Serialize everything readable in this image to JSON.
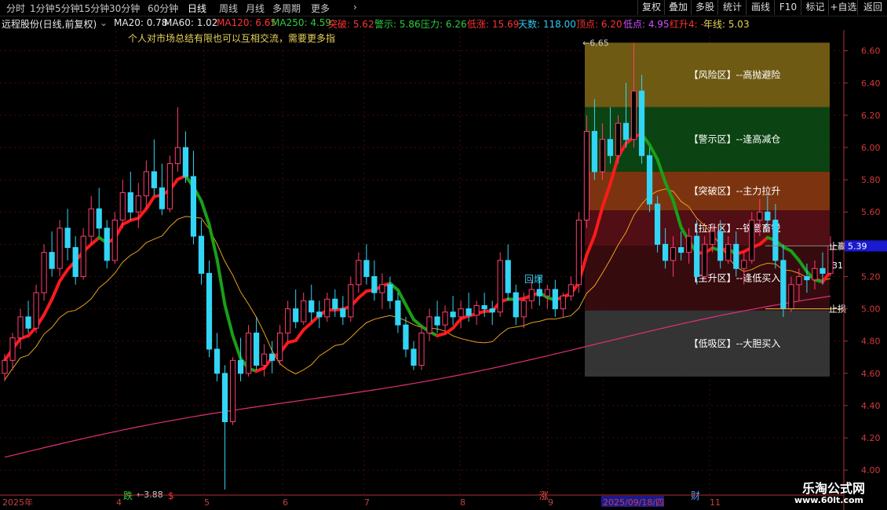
{
  "toolbar": {
    "timeframes": [
      "分时",
      "1分钟",
      "5分钟",
      "15分钟",
      "30分钟",
      "60分钟",
      "日线",
      "周线",
      "月线",
      "多周期",
      "更多"
    ],
    "active_timeframe": "日线",
    "right_buttons": [
      "复权",
      "叠加",
      "多股",
      "统计",
      "画线",
      "F10",
      "标记",
      "+自选",
      "返回"
    ]
  },
  "info": {
    "title": "远程股份(日线,前复权)",
    "ma20": "MA20: 0.78",
    "ma60": "MA60: 1.02",
    "ma120": "MA120: 6.65",
    "ma250": "MA250: 4.59",
    "breakout": "突破: 5.62",
    "warning": "警示: 5.86",
    "pressure": "压力: 6.26",
    "low_rise": "低涨: 15.69",
    "days": "天数: 118.00",
    "top": "顶点: 6.20",
    "bottom": "低点: 4.95",
    "red_rise": "红升4: -",
    "year_line": "年线: 5.03"
  },
  "note": "个人对市场总结有限也可以互相交流，需要更多指",
  "colors": {
    "up": "#ff3d6f",
    "down": "#33d5f5",
    "ma_main_up": "#ff1a1a",
    "ma_main_down": "#18a018",
    "ma250": "#e0307a",
    "ma_orange": "#e6a020",
    "axis": "#b03030"
  },
  "chart_data": {
    "type": "candlestick",
    "y_ticks": [
      "6.60",
      "6.40",
      "6.20",
      "6.00",
      "5.80",
      "5.60",
      "5.40",
      "5.20",
      "5.00",
      "4.80",
      "4.60",
      "4.40",
      "4.20",
      "4.00"
    ],
    "ylim": [
      3.85,
      6.72
    ],
    "x_labels": [
      "2025年",
      "4",
      "5",
      "6",
      "7",
      "8",
      "9",
      "2025/09/18/四",
      "11"
    ],
    "high_mark": "6.65",
    "low_mark": "3.88",
    "current_price": "5.39",
    "right_labels": [
      "止赢",
      "31",
      "止损"
    ],
    "markers": [
      "跌",
      "$",
      "涨",
      "财",
      "回爆"
    ],
    "zones": [
      {
        "label": "【风险区】--高抛避险",
        "from": 6.25,
        "to": 6.65,
        "color": "#7a6414"
      },
      {
        "label": "【警示区】--逢高减仓",
        "from": 5.85,
        "to": 6.25,
        "color": "#0d4a14"
      },
      {
        "label": "【突破区】--主力拉升",
        "from": 5.61,
        "to": 5.85,
        "color": "#8a3a12"
      },
      {
        "label": "【拉升区】--锐意畜锐",
        "from": 5.39,
        "to": 5.61,
        "color": "#5a1016"
      },
      {
        "label": "【主升区】--逢低买入",
        "from": 4.99,
        "to": 5.39,
        "color": "#3c0c0f"
      },
      {
        "label": "【低吸区】--大胆买入",
        "from": 4.58,
        "to": 4.99,
        "color": "#3a3a3a"
      }
    ],
    "candles": [
      [
        4.6,
        4.72,
        4.55,
        4.68
      ],
      [
        4.68,
        4.85,
        4.62,
        4.82
      ],
      [
        4.82,
        5.0,
        4.75,
        4.95
      ],
      [
        4.95,
        5.05,
        4.85,
        4.88
      ],
      [
        4.88,
        5.15,
        4.85,
        5.1
      ],
      [
        5.1,
        5.4,
        5.05,
        5.35
      ],
      [
        5.35,
        5.48,
        5.2,
        5.25
      ],
      [
        5.25,
        5.55,
        5.2,
        5.5
      ],
      [
        5.5,
        5.62,
        5.3,
        5.38
      ],
      [
        5.38,
        5.45,
        5.15,
        5.2
      ],
      [
        5.2,
        5.5,
        5.18,
        5.45
      ],
      [
        5.45,
        5.7,
        5.4,
        5.62
      ],
      [
        5.62,
        5.75,
        5.45,
        5.5
      ],
      [
        5.5,
        5.55,
        5.25,
        5.3
      ],
      [
        5.3,
        5.6,
        5.28,
        5.55
      ],
      [
        5.55,
        5.8,
        5.5,
        5.72
      ],
      [
        5.72,
        5.85,
        5.55,
        5.6
      ],
      [
        5.6,
        5.78,
        5.5,
        5.7
      ],
      [
        5.7,
        5.92,
        5.62,
        5.85
      ],
      [
        5.85,
        6.05,
        5.7,
        5.75
      ],
      [
        5.75,
        5.9,
        5.58,
        5.62
      ],
      [
        5.62,
        5.95,
        5.6,
        5.9
      ],
      [
        5.9,
        6.25,
        5.85,
        6.0
      ],
      [
        6.0,
        6.1,
        5.78,
        5.82
      ],
      [
        5.82,
        5.98,
        5.4,
        5.45
      ],
      [
        5.45,
        5.55,
        5.15,
        5.22
      ],
      [
        5.22,
        5.3,
        4.7,
        4.75
      ],
      [
        4.75,
        4.85,
        4.55,
        4.6
      ],
      [
        4.6,
        4.65,
        3.88,
        4.3
      ],
      [
        4.3,
        4.7,
        4.28,
        4.68
      ],
      [
        4.68,
        4.82,
        4.55,
        4.6
      ],
      [
        4.6,
        4.9,
        4.58,
        4.85
      ],
      [
        4.85,
        4.95,
        4.62,
        4.65
      ],
      [
        4.65,
        4.78,
        4.58,
        4.72
      ],
      [
        4.72,
        4.8,
        4.6,
        4.68
      ],
      [
        4.68,
        4.9,
        4.65,
        4.85
      ],
      [
        4.85,
        5.05,
        4.8,
        5.0
      ],
      [
        5.0,
        5.12,
        4.88,
        4.92
      ],
      [
        4.92,
        5.1,
        4.9,
        5.05
      ],
      [
        5.05,
        5.15,
        4.92,
        4.98
      ],
      [
        4.98,
        5.05,
        4.88,
        4.95
      ],
      [
        4.95,
        5.1,
        4.92,
        5.06
      ],
      [
        5.06,
        5.12,
        4.95,
        5.0
      ],
      [
        5.0,
        5.08,
        4.9,
        4.95
      ],
      [
        4.95,
        5.2,
        4.92,
        5.15
      ],
      [
        5.15,
        5.35,
        5.1,
        5.3
      ],
      [
        5.3,
        5.4,
        5.15,
        5.2
      ],
      [
        5.2,
        5.3,
        5.05,
        5.1
      ],
      [
        5.1,
        5.22,
        5.0,
        5.15
      ],
      [
        5.15,
        5.2,
        5.0,
        5.05
      ],
      [
        5.05,
        5.1,
        4.85,
        4.9
      ],
      [
        4.9,
        4.95,
        4.7,
        4.75
      ],
      [
        4.75,
        4.8,
        4.62,
        4.65
      ],
      [
        4.65,
        4.9,
        4.62,
        4.85
      ],
      [
        4.85,
        5.0,
        4.8,
        4.95
      ],
      [
        4.95,
        5.05,
        4.85,
        4.9
      ],
      [
        4.9,
        5.02,
        4.85,
        4.98
      ],
      [
        4.98,
        5.08,
        4.9,
        4.95
      ],
      [
        4.95,
        5.05,
        4.88,
        5.0
      ],
      [
        5.0,
        5.1,
        4.92,
        4.96
      ],
      [
        4.96,
        5.05,
        4.9,
        5.02
      ],
      [
        5.02,
        5.1,
        4.95,
        5.0
      ],
      [
        5.0,
        5.05,
        4.9,
        4.98
      ],
      [
        4.98,
        5.35,
        4.95,
        5.3
      ],
      [
        5.3,
        5.4,
        5.05,
        5.1
      ],
      [
        5.1,
        5.15,
        4.9,
        4.95
      ],
      [
        4.95,
        5.1,
        4.88,
        5.05
      ],
      [
        5.05,
        5.18,
        5.0,
        5.12
      ],
      [
        5.12,
        5.2,
        5.02,
        5.08
      ],
      [
        5.08,
        5.15,
        5.0,
        5.12
      ],
      [
        5.12,
        5.18,
        4.95,
        5.0
      ],
      [
        5.0,
        5.1,
        4.95,
        5.08
      ],
      [
        5.08,
        5.2,
        5.05,
        5.15
      ],
      [
        5.15,
        5.6,
        5.1,
        5.55
      ],
      [
        5.55,
        6.2,
        5.5,
        6.1
      ],
      [
        6.1,
        6.3,
        5.8,
        5.85
      ],
      [
        5.85,
        6.15,
        5.8,
        6.05
      ],
      [
        6.05,
        6.25,
        5.9,
        5.95
      ],
      [
        5.95,
        6.2,
        5.9,
        6.15
      ],
      [
        6.15,
        6.4,
        6.0,
        6.05
      ],
      [
        6.05,
        6.65,
        6.0,
        6.35
      ],
      [
        6.35,
        6.45,
        5.9,
        5.95
      ],
      [
        5.95,
        6.0,
        5.6,
        5.65
      ],
      [
        5.65,
        5.7,
        5.35,
        5.4
      ],
      [
        5.4,
        5.5,
        5.25,
        5.3
      ],
      [
        5.3,
        5.45,
        5.2,
        5.38
      ],
      [
        5.38,
        5.48,
        5.3,
        5.35
      ],
      [
        5.35,
        5.5,
        5.28,
        5.45
      ],
      [
        5.45,
        5.55,
        5.15,
        5.2
      ],
      [
        5.2,
        5.45,
        5.18,
        5.4
      ],
      [
        5.4,
        5.52,
        5.35,
        5.48
      ],
      [
        5.48,
        5.55,
        5.25,
        5.3
      ],
      [
        5.3,
        5.45,
        5.28,
        5.4
      ],
      [
        5.4,
        5.48,
        5.2,
        5.25
      ],
      [
        5.25,
        5.35,
        5.15,
        5.3
      ],
      [
        5.3,
        5.6,
        5.28,
        5.55
      ],
      [
        5.55,
        5.68,
        5.45,
        5.6
      ],
      [
        5.6,
        5.7,
        5.5,
        5.55
      ],
      [
        5.55,
        5.65,
        5.25,
        5.3
      ],
      [
        5.3,
        5.4,
        4.95,
        5.0
      ],
      [
        5.0,
        5.2,
        4.98,
        5.15
      ],
      [
        5.15,
        5.25,
        5.05,
        5.2
      ],
      [
        5.2,
        5.28,
        5.1,
        5.18
      ],
      [
        5.18,
        5.3,
        5.12,
        5.25
      ],
      [
        5.25,
        5.35,
        5.15,
        5.22
      ],
      [
        5.22,
        5.45,
        5.2,
        5.39
      ]
    ]
  }
}
